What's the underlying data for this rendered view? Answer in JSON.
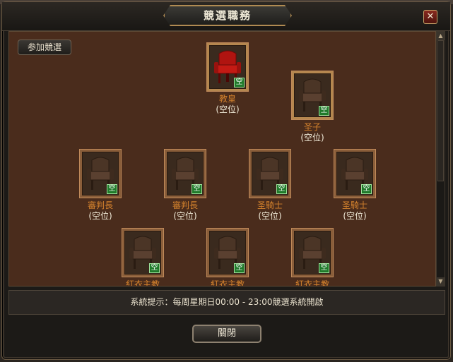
{
  "window": {
    "title": "競選職務",
    "close_glyph": "✕"
  },
  "join_button": "参加競選",
  "seats": [
    {
      "name": "教皇",
      "status": "(空位)",
      "badge": "空",
      "color": "red"
    },
    {
      "name": "圣子",
      "status": "(空位)",
      "badge": "空",
      "color": "brown"
    },
    {
      "name": "審判長",
      "status": "(空位)",
      "badge": "空",
      "color": "brown"
    },
    {
      "name": "審判長",
      "status": "(空位)",
      "badge": "空",
      "color": "brown"
    },
    {
      "name": "圣騎士",
      "status": "(空位)",
      "badge": "空",
      "color": "brown"
    },
    {
      "name": "圣騎士",
      "status": "(空位)",
      "badge": "空",
      "color": "brown"
    },
    {
      "name": "紅衣主教",
      "status": "",
      "badge": "空",
      "color": "brown"
    },
    {
      "name": "紅衣主教",
      "status": "",
      "badge": "空",
      "color": "brown"
    },
    {
      "name": "紅衣主教",
      "status": "",
      "badge": "空",
      "color": "brown"
    }
  ],
  "notice": "系統提示：每周星期日00:00 - 23:00競選系統開啟",
  "close_button": "關閉",
  "colors": {
    "accent_gold": "#b08b52",
    "seat_name": "#d4822d",
    "empty_badge": "#1f7a2a"
  }
}
